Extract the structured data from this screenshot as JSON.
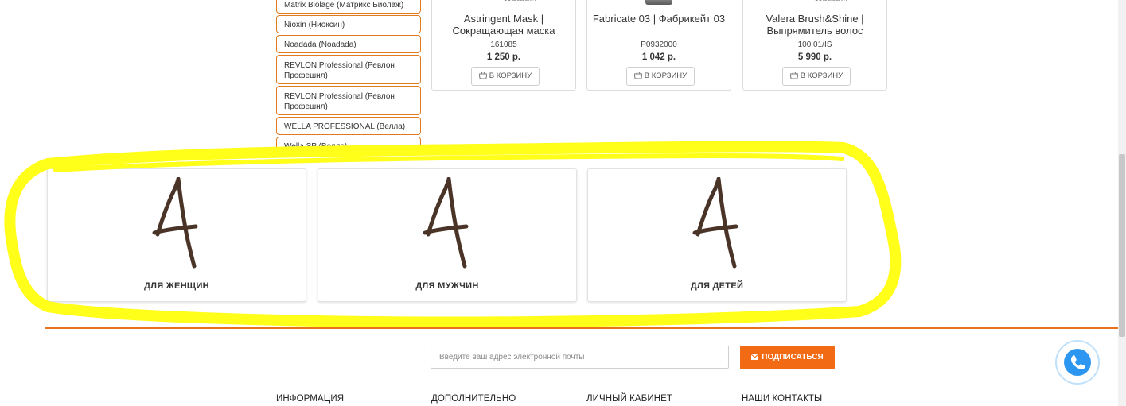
{
  "brands": [
    {
      "label": "Matrix Biolage (Матрикс Биолаж)",
      "lines": 1
    },
    {
      "label": "Nioxin (Ниоксин)",
      "lines": 1
    },
    {
      "label": "Noadada (Noadada)",
      "lines": 1
    },
    {
      "label": "REVLON Professional (Ревлон Профешнл)",
      "lines": 2
    },
    {
      "label": "REVLON Professional (Ревлон Профешнл)",
      "lines": 2
    },
    {
      "label": "WELLA PROFESSIONAL (Велла)",
      "lines": 1
    },
    {
      "label": "Wella SP (Велла)",
      "lines": 1
    }
  ],
  "products": [
    {
      "title": "Astringent Mask | Сокращающая маска",
      "code": "161085",
      "price": "1 250 р.",
      "cart_label": "В КОРЗИНУ"
    },
    {
      "title": "Fabricate 03 | Фабрикейт 03",
      "code": "P0932000",
      "price": "1 042 р.",
      "cart_label": "В КОРЗИНУ"
    },
    {
      "title": "Valera Brush&Shine | Выпрямитель волос",
      "code": "100.01/IS",
      "price": "5 990 р.",
      "cart_label": "В КОРЗИНУ"
    }
  ],
  "categories": [
    {
      "label": "ДЛЯ ЖЕНЩИН",
      "logo": "letter-a-logo"
    },
    {
      "label": "ДЛЯ МУЖЧИН",
      "logo": "letter-a-logo"
    },
    {
      "label": "ДЛЯ ДЕТЕЙ",
      "logo": "letter-a-logo"
    }
  ],
  "subscribe": {
    "placeholder": "Введите ваш адрес электронной почты",
    "button_label": "ПОДПИСАТЬСЯ",
    "button_icon": "envelope-icon"
  },
  "footer": {
    "columns": [
      "ИНФОРМАЦИЯ",
      "ДОПОЛНИТЕЛЬНО",
      "ЛИЧНЫЙ КАБИНЕТ",
      "НАШИ КОНТАКТЫ"
    ]
  },
  "colors": {
    "accent": "#f26a13",
    "brand_border": "#e07a1f",
    "highlight": "#ffff1a",
    "call_widget": "#2c96f0"
  },
  "icons": {
    "cart": "basket-icon",
    "call": "phone-icon"
  }
}
